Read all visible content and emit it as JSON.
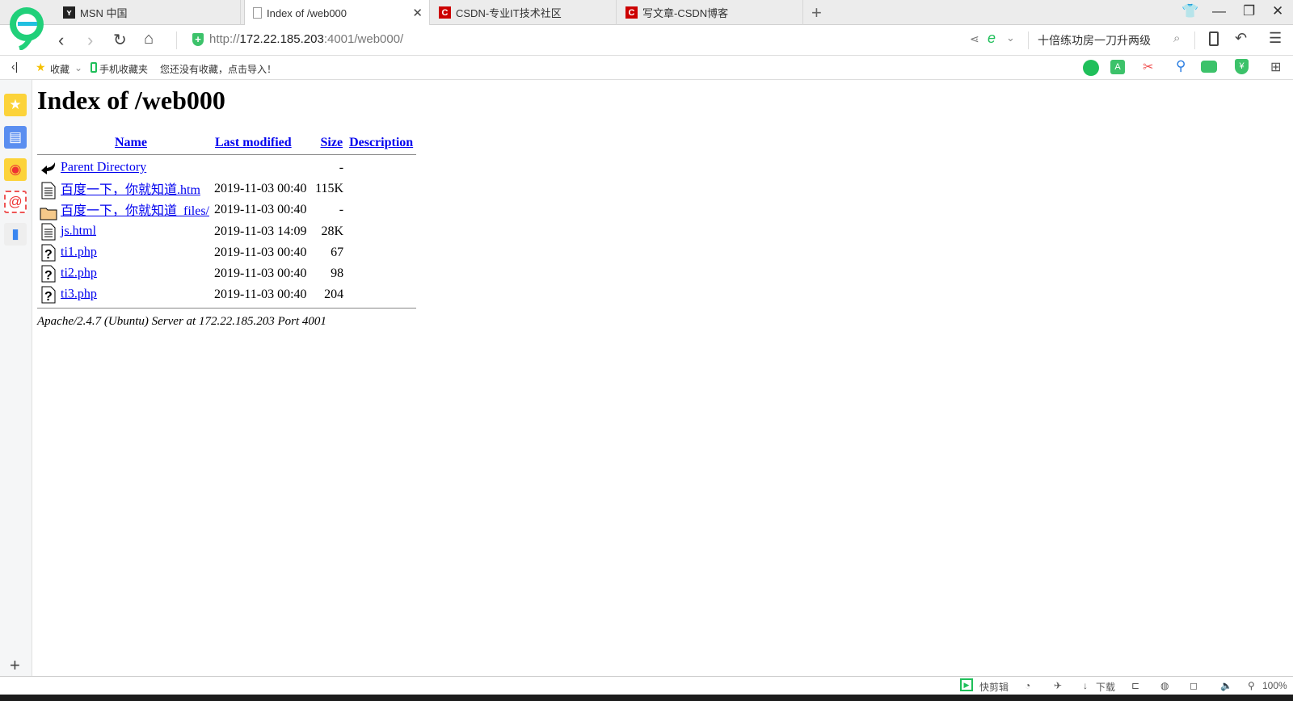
{
  "browser": {
    "tabs": [
      {
        "label": "MSN 中国",
        "icon": "msn-icon",
        "active": false
      },
      {
        "label": "Index of /web000",
        "icon": "page-icon",
        "active": true
      },
      {
        "label": "CSDN-专业IT技术社区",
        "icon": "csdn-icon",
        "active": false
      },
      {
        "label": "写文章-CSDN博客",
        "icon": "csdn-icon",
        "active": false
      }
    ],
    "url_prefix": "http://",
    "url_host": "172.22.185.203",
    "url_rest": ":4001/web000/",
    "search_hint": "十倍练功房一刀升两级",
    "bookmarks": {
      "favorites": "收藏",
      "mobile": "手机收藏夹",
      "empty_hint": "您还没有收藏，点击导入！"
    },
    "status": {
      "quick_edit": "快剪辑",
      "download": "下载",
      "zoom": "100%"
    },
    "accent": "#1fbf5a"
  },
  "page": {
    "title": "Index of /web000",
    "columns": [
      "Name",
      "Last modified",
      "Size",
      "Description"
    ],
    "rows": [
      {
        "icon": "back-icon",
        "name": "Parent Directory",
        "modified": "",
        "size": "-"
      },
      {
        "icon": "text-file-icon",
        "name": "百度一下，你就知道.htm",
        "modified": "2019-11-03 00:40",
        "size": "115K"
      },
      {
        "icon": "folder-icon",
        "name": "百度一下，你就知道_files/",
        "modified": "2019-11-03 00:40",
        "size": "-"
      },
      {
        "icon": "text-file-icon",
        "name": "js.html",
        "modified": "2019-11-03 14:09",
        "size": "28K"
      },
      {
        "icon": "unknown-file-icon",
        "name": "ti1.php",
        "modified": "2019-11-03 00:40",
        "size": "67"
      },
      {
        "icon": "unknown-file-icon",
        "name": "ti2.php",
        "modified": "2019-11-03 00:40",
        "size": "98"
      },
      {
        "icon": "unknown-file-icon",
        "name": "ti3.php",
        "modified": "2019-11-03 00:40",
        "size": "204"
      }
    ],
    "footer": "Apache/2.4.7 (Ubuntu) Server at 172.22.185.203 Port 4001"
  }
}
